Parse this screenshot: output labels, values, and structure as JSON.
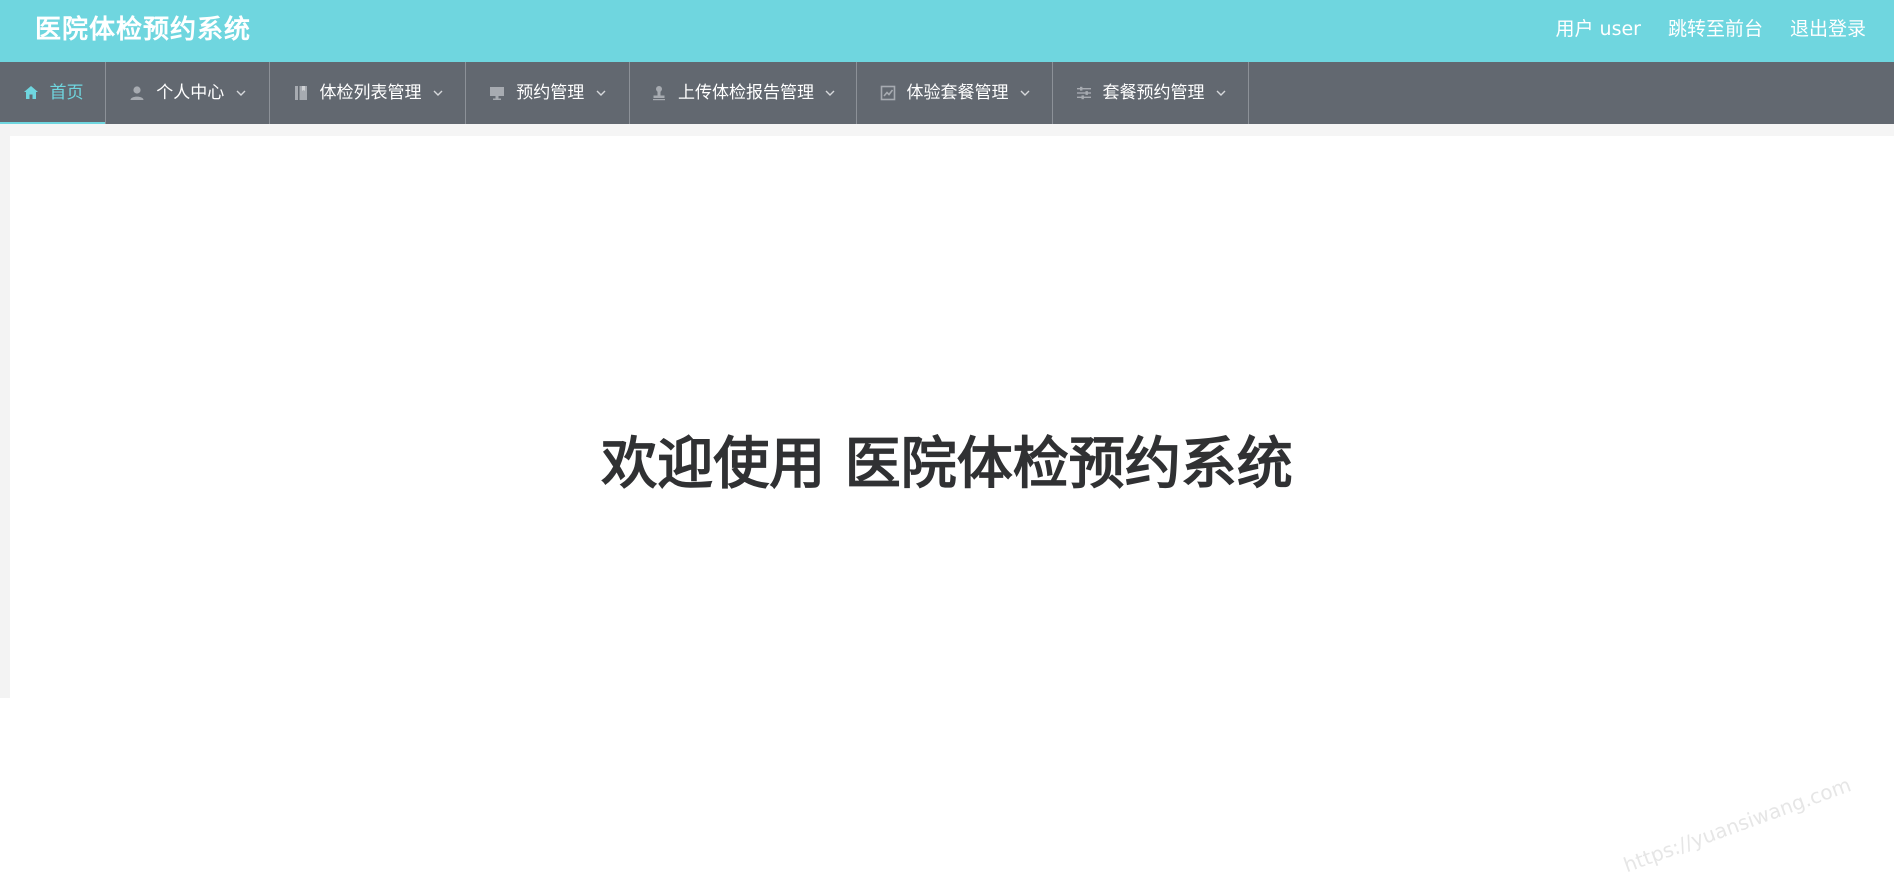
{
  "header": {
    "brand_title": "医院体检预约系统",
    "links": [
      {
        "label": "用户 user"
      },
      {
        "label": "跳转至前台"
      },
      {
        "label": "退出登录"
      }
    ]
  },
  "nav": {
    "items": [
      {
        "label": "首页",
        "icon": "home-icon",
        "active": true
      },
      {
        "label": "个人中心",
        "icon": "user-icon"
      },
      {
        "label": "体检列表管理",
        "icon": "book-icon"
      },
      {
        "label": "预约管理",
        "icon": "monitor-icon"
      },
      {
        "label": "上传体检报告管理",
        "icon": "stamp-icon"
      },
      {
        "label": "体验套餐管理",
        "icon": "chart-icon"
      },
      {
        "label": "套餐预约管理",
        "icon": "sliders-icon"
      }
    ]
  },
  "main": {
    "welcome_text": "欢迎使用 医院体检预约系统"
  },
  "watermark": {
    "text": "https://yuansiwang.com"
  },
  "colors": {
    "accent": "#6fd6df",
    "nav_bg": "#626870",
    "text_dark": "#303133"
  }
}
